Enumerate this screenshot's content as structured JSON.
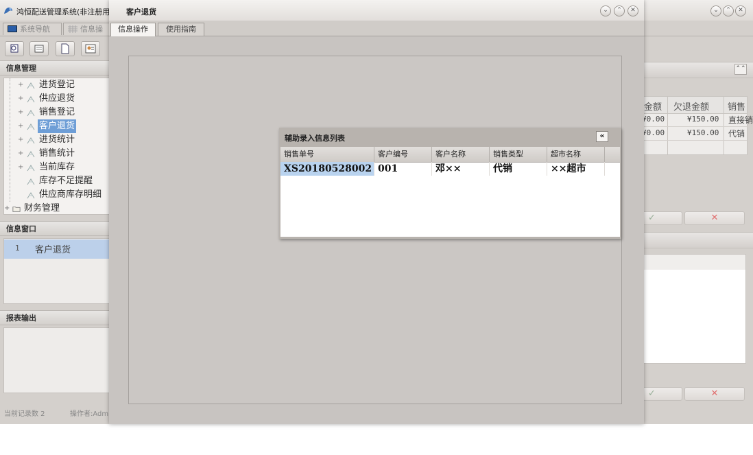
{
  "app": {
    "title": "鸿恒配送管理系统(非注册用",
    "window_controls": [
      "⌄",
      "⌃",
      "✕"
    ]
  },
  "main_tabs": [
    {
      "label": "系统导航"
    },
    {
      "label": "信息操"
    }
  ],
  "panels": {
    "info_manage": "信息管理",
    "info_window": "信息窗口",
    "report_output": "报表输出"
  },
  "tree": [
    {
      "expander": "+",
      "label": "进货登记"
    },
    {
      "expander": "+",
      "label": "供应退货"
    },
    {
      "expander": "+",
      "label": "销售登记"
    },
    {
      "expander": "+",
      "label": "客户退货",
      "selected": true
    },
    {
      "expander": "+",
      "label": "进货统计"
    },
    {
      "expander": "+",
      "label": "销售统计"
    },
    {
      "expander": "+",
      "label": "当前库存"
    },
    {
      "expander": "",
      "label": "库存不足提醒"
    },
    {
      "expander": "",
      "label": "供应商库存明细"
    }
  ],
  "tree_folder": {
    "expander": "+",
    "label": "财务管理"
  },
  "info_window_row": {
    "num": "1",
    "label": "客户退货"
  },
  "status": {
    "record_count": "当前记录数 2",
    "operator": "操作者:Adm"
  },
  "right_grid": {
    "headers": [
      "金额",
      "欠退金额",
      "销售"
    ],
    "rows": [
      [
        "¥0.00",
        "¥150.00",
        "直接销"
      ],
      [
        "¥0.00",
        "¥150.00",
        "代销"
      ]
    ],
    "collapse_icon": "⌃⌃",
    "confirm": "✓",
    "cancel": "✕"
  },
  "dialog": {
    "title": "客户退货",
    "tabs": [
      "信息操作",
      "使用指南"
    ],
    "window_controls": [
      "⌄",
      "⌃",
      "✕"
    ]
  },
  "popup": {
    "title": "辅助录入信息列表",
    "collapse": "«",
    "columns": [
      "销售单号",
      "客户编号",
      "客户名称",
      "销售类型",
      "超市名称"
    ],
    "rows": [
      [
        "XS20180528002",
        "001",
        "邓××",
        "代销",
        "××超市"
      ]
    ]
  },
  "colors": {
    "selection": "#6e9ed6",
    "row_highlight": "#b9d3ef",
    "cancel_red": "#e05050",
    "confirm_green": "#88a888"
  }
}
